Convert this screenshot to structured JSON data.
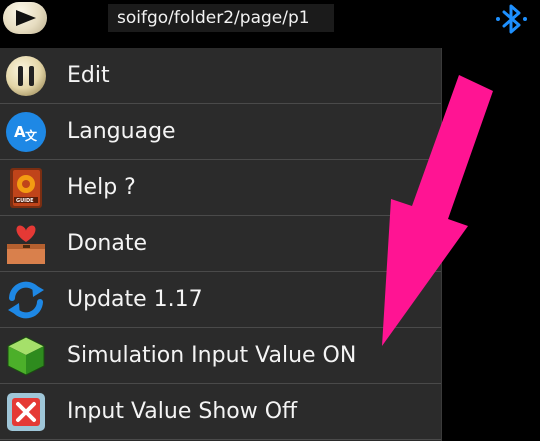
{
  "topbar": {
    "path": "soifgo/folder2/page/p1",
    "play_icon": "play-icon",
    "bluetooth_icon": "bluetooth-icon"
  },
  "menu": {
    "items": [
      {
        "label": "Edit",
        "icon": "pause-icon"
      },
      {
        "label": "Language",
        "icon": "translate-icon"
      },
      {
        "label": "Help ?",
        "icon": "guide-book-icon"
      },
      {
        "label": "Donate",
        "icon": "donate-box-heart-icon"
      },
      {
        "label": "Update  1.17",
        "icon": "refresh-icon"
      },
      {
        "label": "Simulation Input Value ON",
        "icon": "cube-icon"
      },
      {
        "label": "Input Value Show Off",
        "icon": "close-box-icon"
      }
    ]
  },
  "colors": {
    "background": "#000000",
    "menu_bg": "#2b2b2b",
    "separator": "#4a4a4a",
    "arrow": "#ff1493",
    "bluetooth": "#1e90ff"
  }
}
